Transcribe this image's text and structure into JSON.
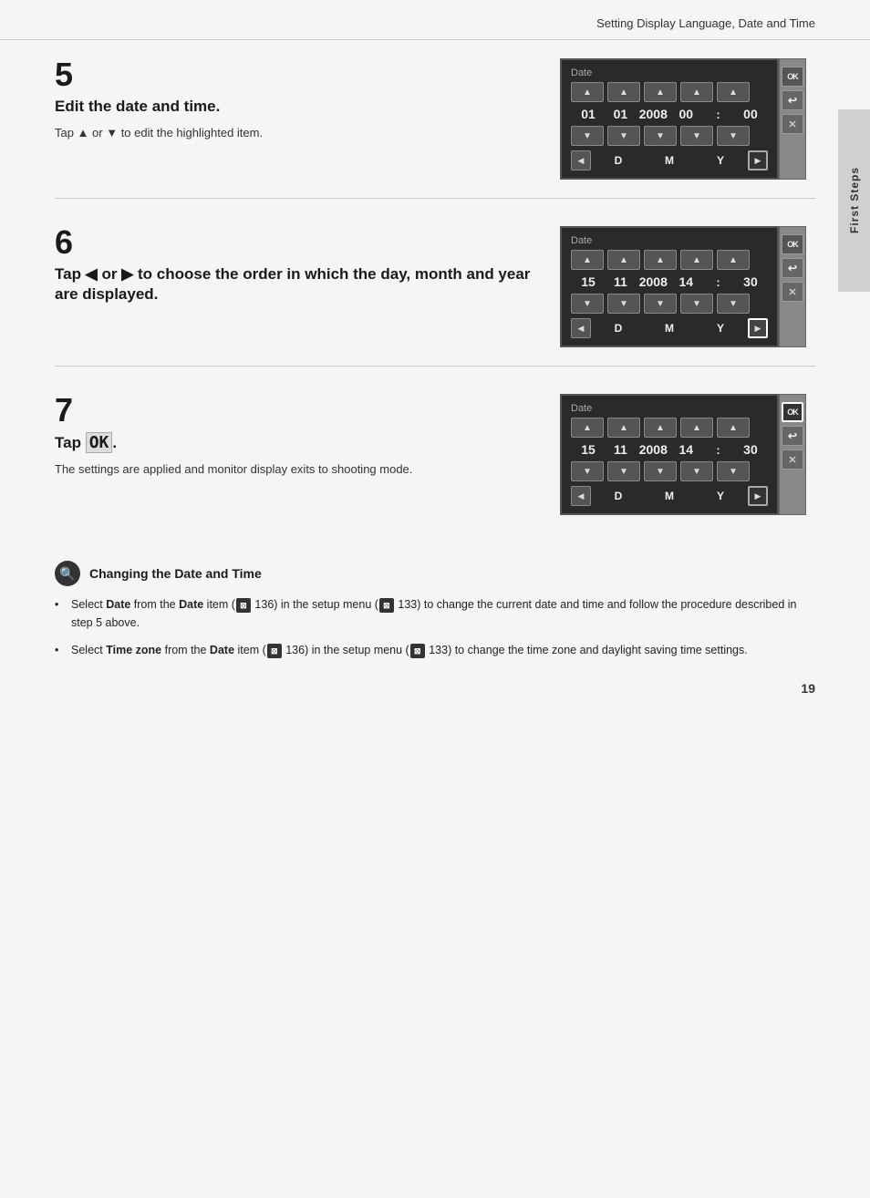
{
  "header": {
    "title": "Setting Display Language, Date and Time"
  },
  "sidebar": {
    "label": "First Steps"
  },
  "steps": [
    {
      "number": "5",
      "title": "Edit the date and time.",
      "desc_prefix": "Tap ",
      "desc_up": "▲",
      "desc_or": " or ",
      "desc_down": "▼",
      "desc_suffix": " to edit the highlighted item.",
      "screen": {
        "title": "Date",
        "row1": [
          "01",
          "01",
          "2008",
          "00",
          ":",
          "00"
        ],
        "nav": [
          "D",
          "M",
          "Y"
        ],
        "highlight": "none"
      }
    },
    {
      "number": "6",
      "title_part1": "Tap ",
      "title_left": "◀",
      "title_or": " or ",
      "title_right": "▶",
      "title_part2": " to choose the order in which",
      "title_line2": "the day, month and year are displayed.",
      "screen": {
        "title": "Date",
        "row1": [
          "15",
          "11",
          "2008",
          "14",
          ":",
          "30"
        ],
        "nav": [
          "D",
          "M",
          "Y"
        ],
        "highlight": "right-nav"
      }
    },
    {
      "number": "7",
      "title_pre": "Tap ",
      "title_ok": "OK",
      "title_post": ".",
      "desc": "The settings are applied and monitor display exits to shooting mode.",
      "screen": {
        "title": "Date",
        "row1": [
          "15",
          "11",
          "2008",
          "14",
          ":",
          "30"
        ],
        "nav": [
          "D",
          "M",
          "Y"
        ],
        "highlight": "ok-btn"
      }
    }
  ],
  "note": {
    "title": "Changing the Date and Time",
    "items": [
      {
        "text_parts": [
          {
            "text": "Select ",
            "bold": false
          },
          {
            "text": "Date",
            "bold": true
          },
          {
            "text": " from the ",
            "bold": false
          },
          {
            "text": "Date",
            "bold": true
          },
          {
            "text": " item (",
            "bold": false
          },
          {
            "text": "ref136",
            "ref": true
          },
          {
            "text": " 136) in the setup menu (",
            "bold": false
          },
          {
            "text": "ref133",
            "ref": true
          },
          {
            "text": " 133) to change the current date and time and follow the procedure described in step 5 above.",
            "bold": false
          }
        ]
      },
      {
        "text_parts": [
          {
            "text": "Select ",
            "bold": false
          },
          {
            "text": "Time zone",
            "bold": true
          },
          {
            "text": " from the ",
            "bold": false
          },
          {
            "text": "Date",
            "bold": true
          },
          {
            "text": " item (",
            "bold": false
          },
          {
            "text": "ref136",
            "ref": true
          },
          {
            "text": " 136) in the setup menu (",
            "bold": false
          },
          {
            "text": "ref133",
            "ref": true
          },
          {
            "text": " 133) to change the time zone and daylight saving time settings.",
            "bold": false
          }
        ]
      }
    ]
  },
  "page_number": "19"
}
